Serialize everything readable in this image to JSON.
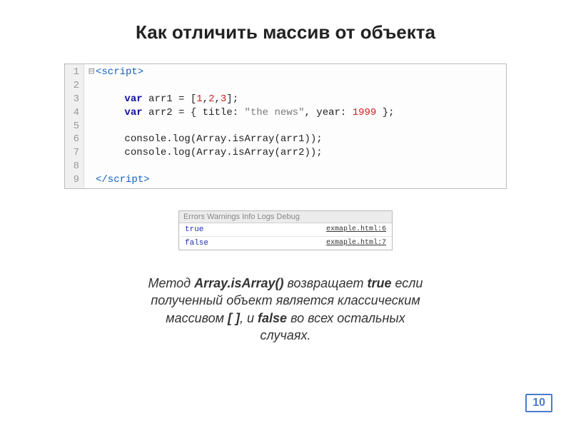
{
  "title": "Как отличить массив от объекта",
  "code": {
    "lines": [
      "1",
      "2",
      "3",
      "4",
      "5",
      "6",
      "7",
      "8",
      "9"
    ],
    "fold_open": "⊟",
    "tag_open": "<script>",
    "tag_close": "</scr",
    "tag_close2": "ipt>",
    "kw_var": "var",
    "ident_arr1": " arr1 = [",
    "n1": "1",
    "c": ",",
    "n2": "2",
    "n3": "3",
    "arr1_end": "];",
    "ident_arr2": " arr2 = { title: ",
    "str_news": "\"the news\"",
    "arr2_mid": ", year: ",
    "n1999": "1999",
    "arr2_end": " };",
    "log1": "console.log(Array.isArray(arr1));",
    "log2": "console.log(Array.isArray(arr2));"
  },
  "console": {
    "tabs": "Errors  Warnings  Info  Logs  Debug",
    "rows": [
      {
        "val": "true",
        "src": "exmaple.html:6"
      },
      {
        "val": "false",
        "src": "exmaple.html:7"
      }
    ]
  },
  "desc": {
    "p1a": "Метод ",
    "p1b": "Array.isArray()",
    "p1c": " возвращает ",
    "p1d": "true",
    "p1e": " если",
    "p2a": "полученный объект является классическим",
    "p3a": "массивом ",
    "p3b": "[ ]",
    "p3c": ", и ",
    "p3d": "false",
    "p3e": " во всех остальных",
    "p4a": "случаях."
  },
  "page_number": "10"
}
